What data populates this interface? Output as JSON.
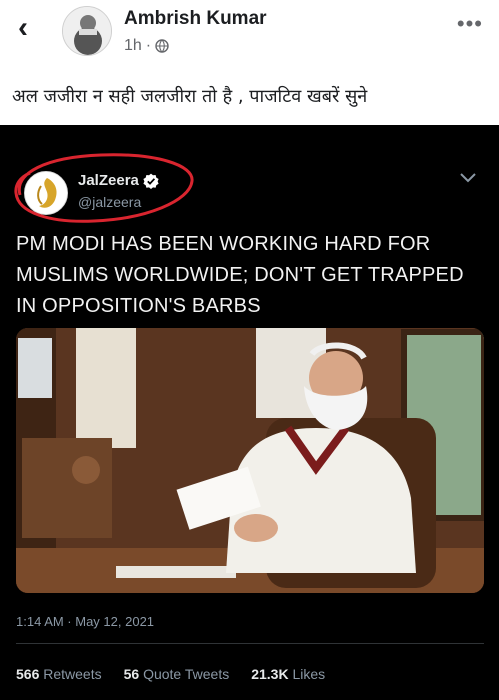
{
  "facebook_post": {
    "author": "Ambrish Kumar",
    "time": "1h",
    "caption": "अल जजीरा न सही जलजीरा तो है , पाजटिव खबरें सुने"
  },
  "tweet": {
    "display_name": "JalZeera",
    "handle": "@jalzeera",
    "text": "PM MODI HAS BEEN WORKING HARD FOR MUSLIMS WORLDWIDE; DON'T GET TRAPPED IN OPPOSITION'S BARBS",
    "timestamp": "1:14 AM · May 12, 2021",
    "stats": {
      "retweets_count": "566",
      "retweets_label": "Retweets",
      "quote_count": "56",
      "quote_label": "Quote Tweets",
      "likes_count": "21.3K",
      "likes_label": "Likes"
    }
  },
  "colors": {
    "facebook_text": "#1c1e21",
    "facebook_meta": "#65676b",
    "tweet_background": "#000000",
    "annotation_circle": "#d9252f",
    "verified_badge": "#ffffff"
  },
  "icons": [
    "back-arrow-icon",
    "globe-icon",
    "more-options-icon",
    "verified-badge-icon",
    "chevron-down-icon"
  ]
}
